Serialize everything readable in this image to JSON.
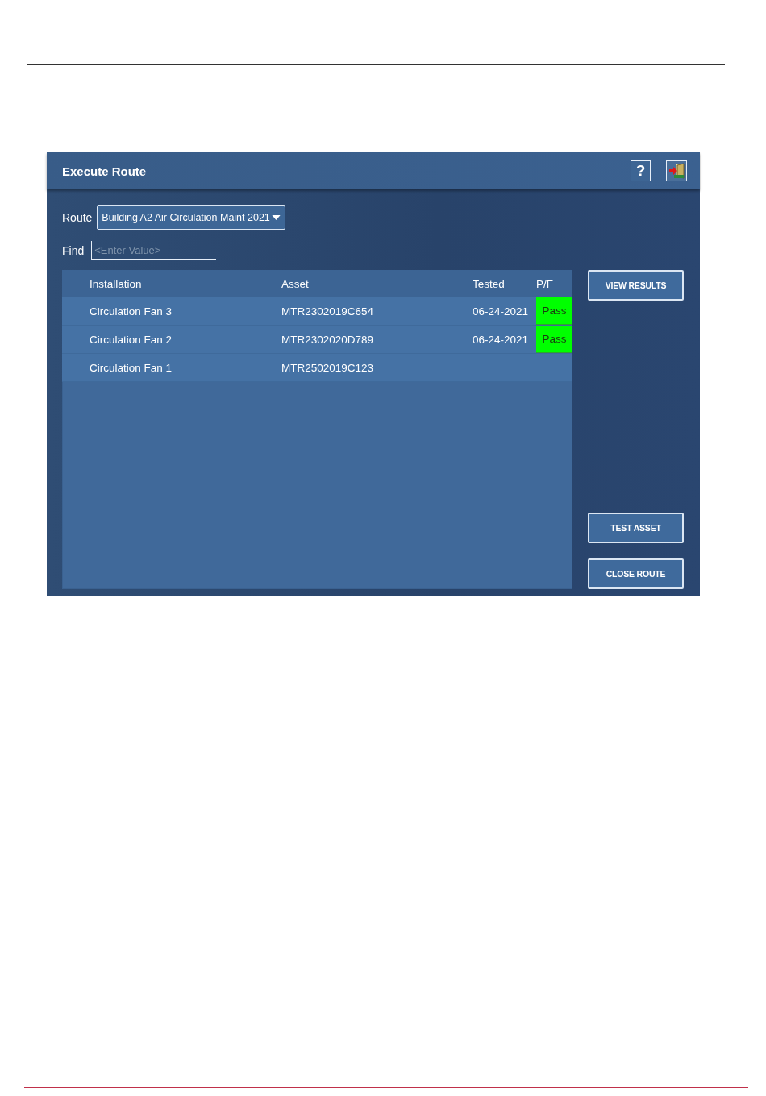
{
  "screen": {
    "title": "Execute Route",
    "help_button": "?"
  },
  "route": {
    "label": "Route",
    "value": "Building A2 Air Circulation Maint 2021"
  },
  "find": {
    "label": "Find",
    "placeholder": "<Enter Value>"
  },
  "table": {
    "columns": [
      "Installation",
      "Asset",
      "Tested",
      "P/F"
    ],
    "rows": [
      {
        "installation": "Circulation Fan 3",
        "asset": "MTR2302019C654",
        "tested": "06-24-2021",
        "result": "Pass",
        "color": "#00ff00"
      },
      {
        "installation": "Circulation Fan 2",
        "asset": "MTR2302020D789",
        "tested": "06-24-2021",
        "result": "Pass",
        "color": "#00ff00"
      },
      {
        "installation": "Circulation Fan 1",
        "asset": "MTR2502019C123"
      }
    ]
  },
  "actions": {
    "top": [
      "VIEW RESULTS"
    ],
    "bottom": [
      "TEST ASSET",
      "CLOSE ROUTE"
    ]
  }
}
